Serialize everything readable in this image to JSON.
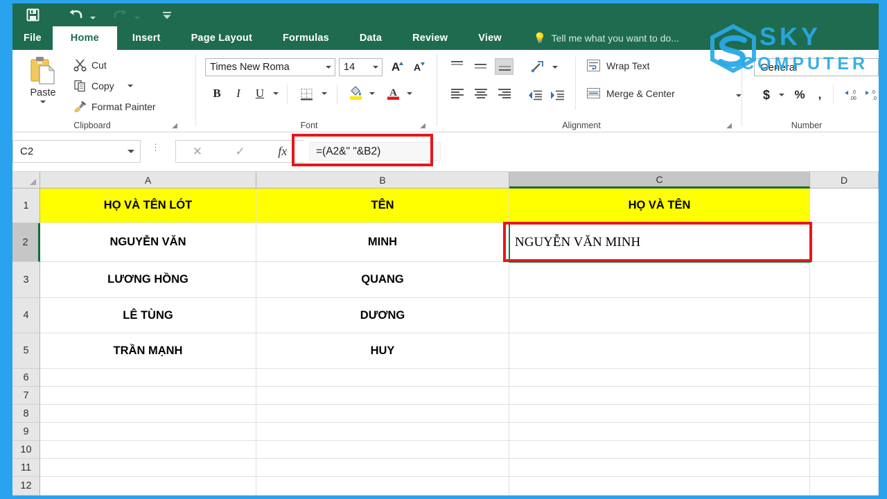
{
  "window": {
    "quick_access": [
      {
        "name": "save",
        "label": "Save",
        "icon": "save-icon",
        "enabled": true
      },
      {
        "name": "undo",
        "label": "Undo",
        "icon": "undo-icon",
        "enabled": true
      },
      {
        "name": "redo",
        "label": "Redo",
        "icon": "redo-icon",
        "enabled": false
      },
      {
        "name": "customize",
        "label": "Customize Quick Access Toolbar",
        "icon": "chevron-down-icon",
        "enabled": true
      }
    ]
  },
  "ribbon": {
    "tabs": [
      {
        "label": "File",
        "active": false
      },
      {
        "label": "Home",
        "active": true
      },
      {
        "label": "Insert",
        "active": false
      },
      {
        "label": "Page Layout",
        "active": false
      },
      {
        "label": "Formulas",
        "active": false
      },
      {
        "label": "Data",
        "active": false
      },
      {
        "label": "Review",
        "active": false
      },
      {
        "label": "View",
        "active": false
      }
    ],
    "tellme": "Tell me what you want to do...",
    "groups": {
      "clipboard": {
        "label": "Clipboard",
        "paste": "Paste",
        "cut": "Cut",
        "copy": "Copy",
        "format_painter": "Format Painter"
      },
      "font": {
        "label": "Font",
        "font_name": "Times New Roma",
        "font_size": "14",
        "bold": "B",
        "italic": "I",
        "underline": "U"
      },
      "alignment": {
        "label": "Alignment",
        "wrap_text": "Wrap Text",
        "merge_center": "Merge & Center"
      },
      "number": {
        "label": "Number",
        "format": "General",
        "currency": "$",
        "percent": "%",
        "comma": ","
      }
    }
  },
  "formula_bar": {
    "name_box": "C2",
    "formula": "=(A2&\" \"&B2)",
    "cancel_icon": "close-icon",
    "enter_icon": "check-icon",
    "function_icon": "fx-icon"
  },
  "sheet": {
    "columns": [
      "A",
      "B",
      "C",
      "D"
    ],
    "active_column": "C",
    "active_row": "2",
    "rows": [
      "1",
      "2",
      "3",
      "4",
      "5",
      "6",
      "7",
      "8",
      "9",
      "10",
      "11",
      "12"
    ],
    "data": [
      {
        "row": "1",
        "A": "HỌ VÀ TÊN LÓT",
        "B": "TÊN",
        "C": "HỌ VÀ TÊN",
        "style": "header"
      },
      {
        "row": "2",
        "A": "NGUYỄN VĂN",
        "B": "MINH",
        "C": "NGUYỄN VĂN  MINH",
        "style": "data"
      },
      {
        "row": "3",
        "A": "LƯƠNG HỒNG",
        "B": "QUANG",
        "C": "",
        "style": "data"
      },
      {
        "row": "4",
        "A": "LÊ TÙNG",
        "B": "DƯƠNG",
        "C": "",
        "style": "data"
      },
      {
        "row": "5",
        "A": "TRẦN MẠNH",
        "B": "HUY",
        "C": "",
        "style": "data"
      },
      {
        "row": "6",
        "A": "",
        "B": "",
        "C": "",
        "style": "data"
      },
      {
        "row": "7",
        "A": "",
        "B": "",
        "C": "",
        "style": "data"
      },
      {
        "row": "8",
        "A": "",
        "B": "",
        "C": "",
        "style": "data"
      },
      {
        "row": "9",
        "A": "",
        "B": "",
        "C": "",
        "style": "data"
      },
      {
        "row": "10",
        "A": "",
        "B": "",
        "C": "",
        "style": "data"
      },
      {
        "row": "11",
        "A": "",
        "B": "",
        "C": "",
        "style": "data"
      },
      {
        "row": "12",
        "A": "",
        "B": "",
        "C": "",
        "style": "data"
      }
    ]
  },
  "watermark": {
    "line1": "SKY",
    "line2": "COMPUTER"
  },
  "colors": {
    "ribbon_green": "#1e6b4f",
    "frame_blue": "#29a3ee",
    "header_yellow": "#ffff00",
    "annotation_red": "#e8161a",
    "selection_green": "#107c41",
    "watermark_blue": "#29a9e6"
  }
}
